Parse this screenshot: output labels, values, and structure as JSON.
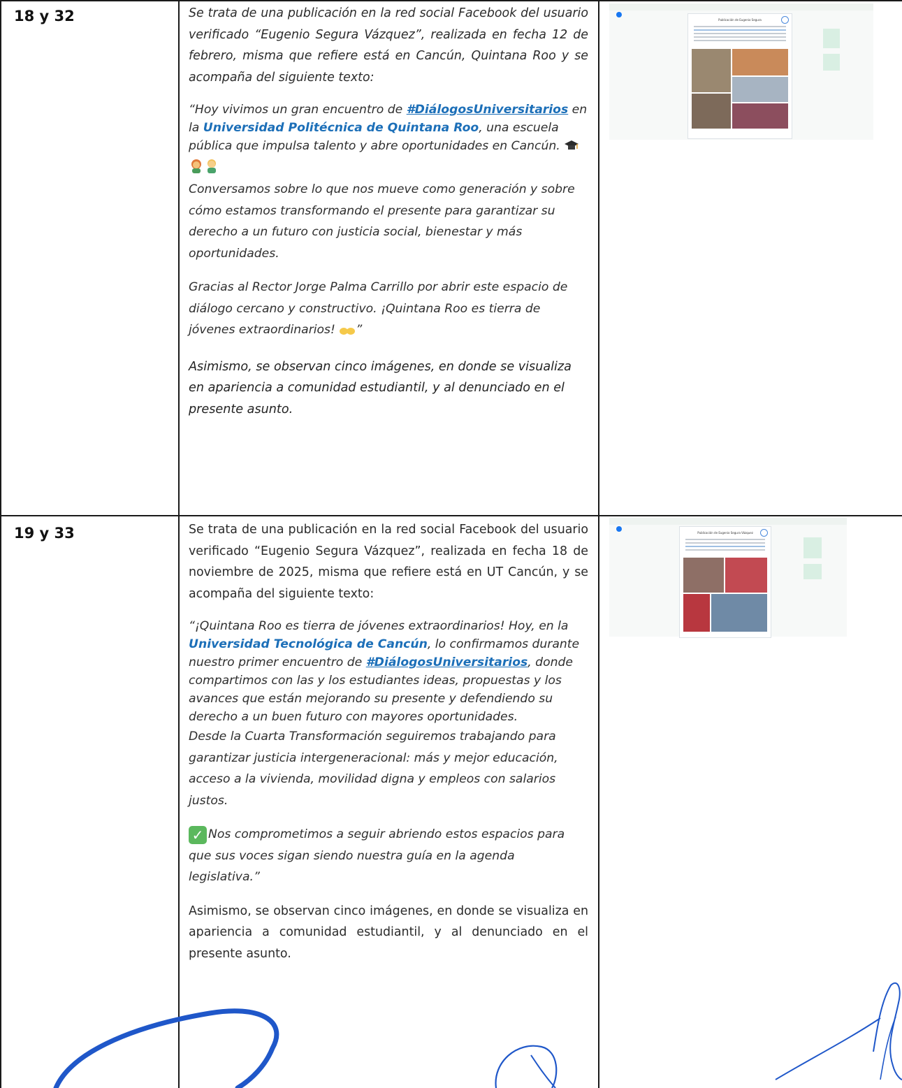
{
  "rows": [
    {
      "number": "18 y 32",
      "intro": "Se trata de una publicación en la red social Facebook del usuario verificado “Eugenio Segura Vázquez”, realizada en fecha 12 de febrero, misma que refiere está en Cancún, Quintana Roo y se acompaña del siguiente texto:",
      "quote": {
        "open": "“Hoy vivimos un gran encuentro de ",
        "hashtag": "#DiálogosUniversitarios",
        "mid1": " en la ",
        "university": "Universidad Politécnica de Quintana Roo",
        "mid2": ", una escuela pública que impulsa talento y abre oportunidades en Cancún.",
        "para2": "Conversamos sobre lo que nos mueve como generación y sobre cómo estamos transformando el presente para garantizar su derecho a un futuro con justicia social, bienestar y más oportunidades.",
        "para3": "Gracias al Rector Jorge Palma Carrillo por abrir este espacio de diálogo cercano y constructivo. ¡Quintana Roo es tierra de jóvenes extraordinarios!",
        "close": "”"
      },
      "observation": "Asimismo, se observan cinco imágenes, en donde se visualiza en apariencia a comunidad estudiantil, y al denunciado en el presente asunto.",
      "screenshot": {
        "post_title": "Publicación de Eugenio Segura"
      }
    },
    {
      "number": "19 y 33",
      "intro": "Se trata de una publicación en la red social Facebook del usuario verificado “Eugenio Segura Vázquez”, realizada en fecha 18 de noviembre de 2025, misma que refiere está en UT Cancún, y se acompaña del siguiente texto:",
      "quote": {
        "open": "“¡Quintana Roo es tierra de jóvenes extraordinarios! Hoy, en la ",
        "university": "Universidad Tecnológica de Cancún",
        "mid1": ", lo confirmamos durante nuestro primer encuentro de ",
        "hashtag": "#DiálogosUniversitarios",
        "mid2": ", donde compartimos con las y los estudiantes ideas, propuestas y los avances que están mejorando su presente y defendiendo su derecho a un buen futuro con mayores oportunidades.",
        "para2": "Desde la Cuarta Transformación seguiremos trabajando para garantizar justicia intergeneracional: más y mejor educación, acceso a la vivienda, movilidad digna y empleos con salarios justos.",
        "para3": "Nos comprometimos a seguir abriendo estos espacios para que sus voces sigan siendo nuestra guía en la agenda legislativa.”"
      },
      "observation": "Asimismo, se observan cinco imágenes, en donde se visualiza en apariencia a comunidad estudiantil, y al denunciado en el presente asunto.",
      "screenshot": {
        "post_title": "Publicación de Eugenio Segura Vázquez"
      }
    }
  ],
  "icons": {
    "emoji_row1_a": "graduation-cap-icon",
    "emoji_row1_b": "student-woman-icon",
    "emoji_row1_c": "student-man-icon",
    "emoji_row1_d": "raising-hands-icon",
    "emoji_row2": "check-mark-icon"
  },
  "colors": {
    "link": "#1c6fb8",
    "ink_signature": "#1f57c9",
    "rule": "#1a1a1a"
  }
}
